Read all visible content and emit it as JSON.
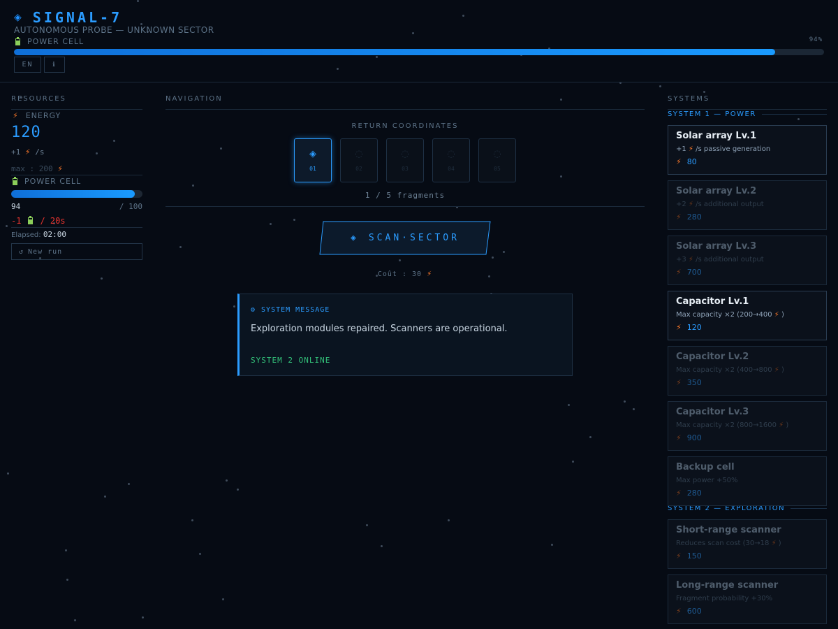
{
  "header": {
    "title": "SIGNAL-7",
    "subtitle": "AUTONOMOUS PROBE — UNKNOWN SECTOR",
    "power_label": "POWER CELL",
    "power_percent_label": "94%",
    "power_fraction": 0.94,
    "lang_button": "EN",
    "icon_button": "ℹ"
  },
  "columns": {
    "resources": "RESOURCES",
    "navigation": "NAVIGATION",
    "systems": "SYSTEMS"
  },
  "resources": {
    "energy_label": "ENERGY",
    "energy_value": "120",
    "rate_prefix": "+1",
    "rate_suffix": "/s",
    "max_text": "max : 200",
    "cell_label": "POWER CELL",
    "cell_value": "94",
    "cell_max": "/ 100",
    "cell_fraction": 0.94,
    "drain_prefix": "-1",
    "drain_suffix": "/ 20s",
    "elapsed_label": "Elapsed:",
    "elapsed_value": "02:00",
    "new_run_label": "New run"
  },
  "navigation": {
    "return_label": "RETURN COORDINATES",
    "fragments": [
      {
        "num": "01",
        "active": true
      },
      {
        "num": "02",
        "active": false
      },
      {
        "num": "03",
        "active": false
      },
      {
        "num": "04",
        "active": false
      },
      {
        "num": "05",
        "active": false
      }
    ],
    "fragment_count": "1 / 5 fragments",
    "scan_label": "SCAN·SECTOR",
    "cost_text": "Coût : 30"
  },
  "message": {
    "title": "SYSTEM MESSAGE",
    "body": "Exploration modules repaired. Scanners are operational.",
    "status": "SYSTEM 2 ONLINE"
  },
  "systems": {
    "system1_label": "SYSTEM 1 — POWER",
    "system2_label": "SYSTEM 2 — EXPLORATION",
    "upgrades": [
      {
        "name": "Solar array Lv.1",
        "desc_pre": "+1",
        "desc_post": "/s passive generation",
        "cost": "80",
        "available": true
      },
      {
        "name": "Solar array Lv.2",
        "desc_pre": "+2",
        "desc_post": "/s additional output",
        "cost": "280",
        "available": false
      },
      {
        "name": "Solar array Lv.3",
        "desc_pre": "+3",
        "desc_post": "/s additional output",
        "cost": "700",
        "available": false
      },
      {
        "name": "Capacitor Lv.1",
        "desc_pre": "Max capacity ×2 (200→400",
        "desc_post": ")",
        "cost": "120",
        "available": true
      },
      {
        "name": "Capacitor Lv.2",
        "desc_pre": "Max capacity ×2 (400→800",
        "desc_post": ")",
        "cost": "350",
        "available": false
      },
      {
        "name": "Capacitor Lv.3",
        "desc_pre": "Max capacity ×2 (800→1600",
        "desc_post": ")",
        "cost": "900",
        "available": false
      },
      {
        "name": "Backup cell",
        "desc_pre": "Max power +50%",
        "desc_post": "",
        "cost": "280",
        "available": false
      },
      {
        "name": "Short-range scanner",
        "desc_pre": "Reduces scan cost (30→18",
        "desc_post": ")",
        "cost": "150",
        "available": false
      },
      {
        "name": "Long-range scanner",
        "desc_pre": "Fragment probability +30%",
        "desc_post": "",
        "cost": "600",
        "available": false
      }
    ]
  },
  "colors": {
    "accent": "#2b9cff",
    "energy": "#ff7a2a",
    "warning": "#e8342f",
    "success": "#33c27a",
    "background": "#060b14"
  }
}
